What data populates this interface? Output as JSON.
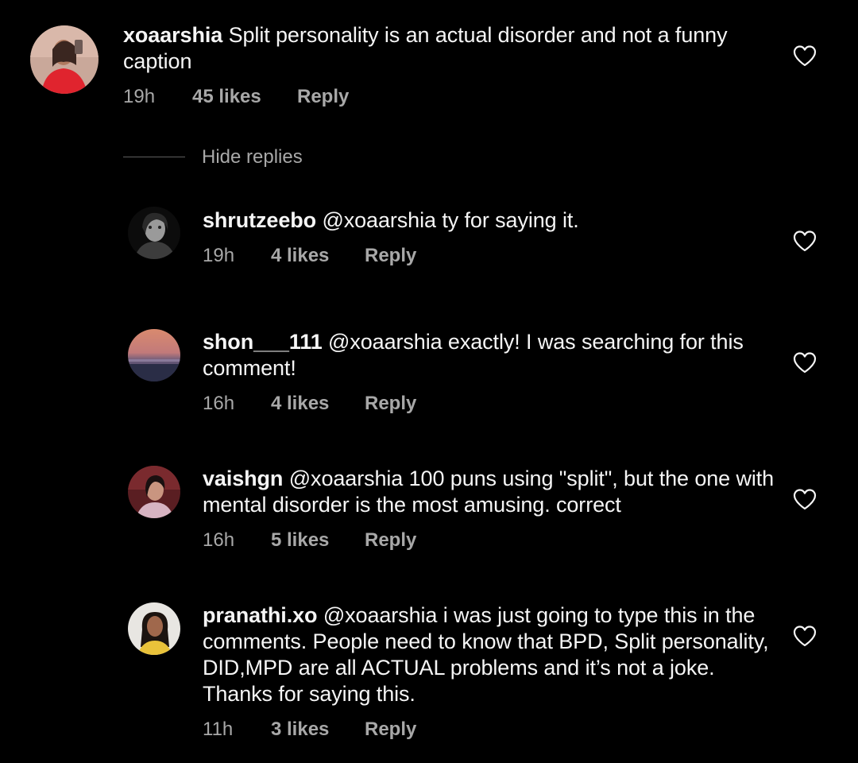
{
  "comments": [
    {
      "username": "xoaarshia",
      "mention": "",
      "text": "Split personality is an actual disorder and not a funny caption",
      "time": "19h",
      "likes": "45 likes",
      "reply": "Reply",
      "heart_icon": "heart-outline-icon"
    },
    {
      "username": "shrutzeebo",
      "mention": "@xoaarshia",
      "text": "ty for saying it.",
      "time": "19h",
      "likes": "4 likes",
      "reply": "Reply",
      "heart_icon": "heart-outline-icon"
    },
    {
      "username": "shon___111",
      "mention": "@xoaarshia",
      "text": "exactly! I was searching for this comment!",
      "time": "16h",
      "likes": "4 likes",
      "reply": "Reply",
      "heart_icon": "heart-outline-icon"
    },
    {
      "username": "vaishgn",
      "mention": "@xoaarshia",
      "text": " 100 puns using \"split\", but the one with mental disorder is the most amusing. correct",
      "time": "16h",
      "likes": "5 likes",
      "reply": "Reply",
      "heart_icon": "heart-outline-icon"
    },
    {
      "username": "pranathi.xo",
      "mention": "@xoaarshia",
      "text": "i was just going to type this in the comments. People need to know that BPD, Split personality, DID,MPD are all ACTUAL problems and it’s not a joke. Thanks for saying this.",
      "time": "11h",
      "likes": "3 likes",
      "reply": "Reply",
      "heart_icon": "heart-outline-icon"
    }
  ],
  "hide_replies": "Hide replies",
  "colors": {
    "background": "#000000",
    "text": "#f5f5f5",
    "secondary": "#a8a8a8",
    "divider": "#5e5e5e"
  }
}
